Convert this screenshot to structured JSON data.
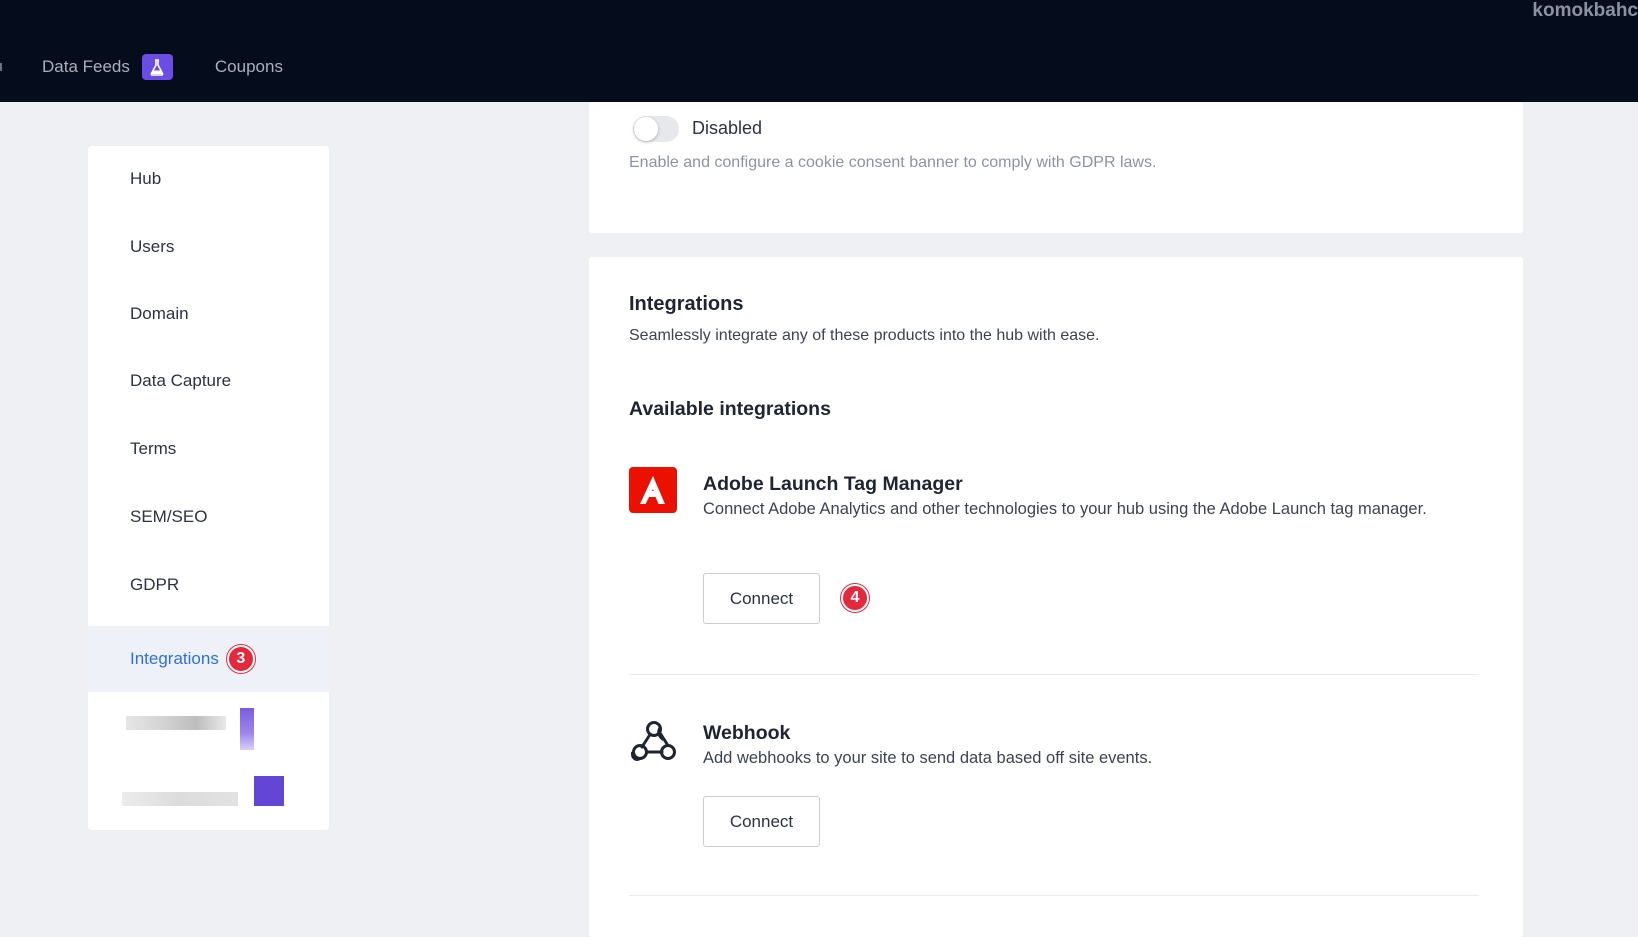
{
  "user": {
    "name": "komokbahc"
  },
  "topnav": {
    "items": [
      {
        "label": "Data Feeds",
        "badge_icon": "flask-icon"
      },
      {
        "label": "Coupons"
      }
    ]
  },
  "sidebar": {
    "items": [
      {
        "label": "Hub"
      },
      {
        "label": "Users"
      },
      {
        "label": "Domain"
      },
      {
        "label": "Data Capture"
      },
      {
        "label": "Terms"
      },
      {
        "label": "SEM/SEO"
      },
      {
        "label": "GDPR"
      },
      {
        "label": "Integrations",
        "badge": "3",
        "active": true
      }
    ]
  },
  "gdpr": {
    "toggle_label": "Disabled",
    "toggle_on": false,
    "description": "Enable and configure a cookie consent banner to comply with GDPR laws."
  },
  "integrations": {
    "title": "Integrations",
    "description": "Seamlessly integrate any of these products into the hub with ease.",
    "available_title": "Available integrations",
    "items": [
      {
        "name": "Adobe Launch Tag Manager",
        "description": "Connect Adobe Analytics and other technologies to your hub using the Adobe Launch tag manager.",
        "button": "Connect",
        "step_badge": "4",
        "icon": "adobe-icon"
      },
      {
        "name": "Webhook",
        "description": "Add webhooks to your site to send data based off site events.",
        "button": "Connect",
        "icon": "webhook-icon"
      }
    ]
  },
  "colors": {
    "topbar": "#050d1c",
    "accent": "#2f6fe4",
    "badge": "#e5283c",
    "adobe": "#eb1000",
    "flask_badge": "#6b4de6"
  }
}
